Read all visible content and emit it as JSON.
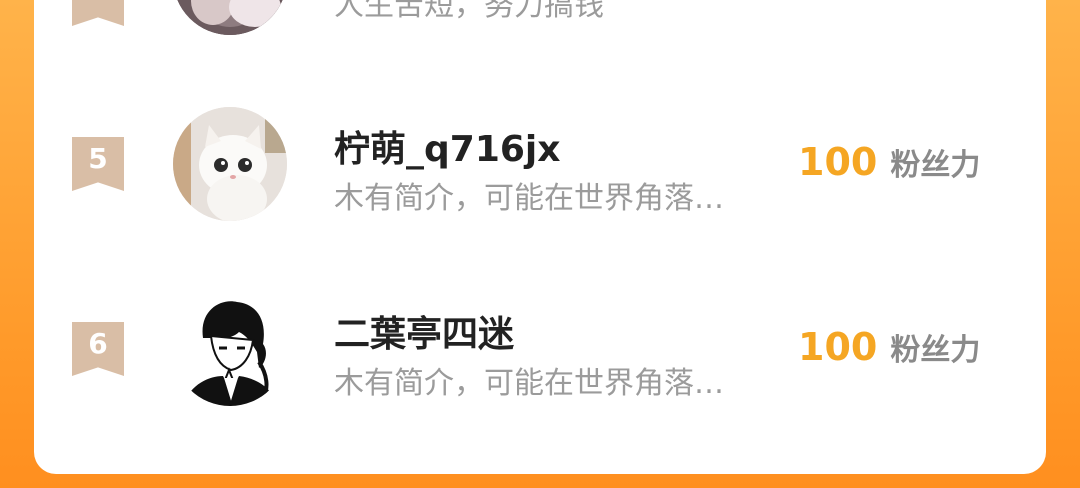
{
  "ranking": {
    "items": [
      {
        "rank": "",
        "name": "",
        "bio": "人生苦短，努力搞钱",
        "avatar_icon": "person-photo-icon"
      },
      {
        "rank": "5",
        "name": "柠萌_q716jx",
        "bio": "木有简介，可能在世界角落…",
        "fans_value": "100",
        "fans_label": "粉丝力",
        "avatar_icon": "white-cat-photo-icon"
      },
      {
        "rank": "6",
        "name": "二葉亭四迷",
        "bio": "木有简介，可能在世界角落…",
        "fans_value": "100",
        "fans_label": "粉丝力",
        "avatar_icon": "anime-character-sketch-icon"
      }
    ]
  },
  "colors": {
    "background": "#ff9f2e",
    "rank_badge": "#d9bea6",
    "fans_value": "#f5a623",
    "fans_label": "#8a8a8a",
    "bio": "#9b9b9b"
  }
}
